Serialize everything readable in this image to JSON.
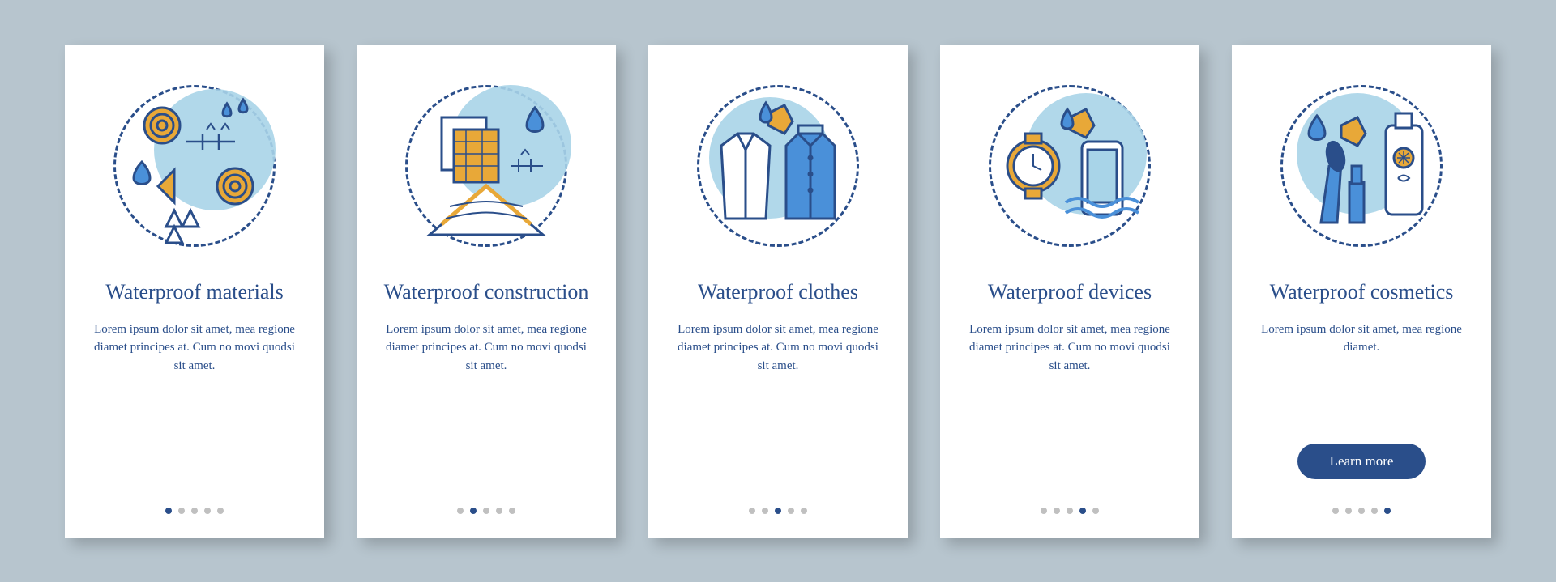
{
  "cards": [
    {
      "title": "Waterproof materials",
      "desc": "Lorem ipsum dolor sit amet, mea regione diamet principes at. Cum no movi quodsi sit amet."
    },
    {
      "title": "Waterproof construction",
      "desc": "Lorem ipsum dolor sit amet, mea regione diamet principes at. Cum no movi quodsi sit amet."
    },
    {
      "title": "Waterproof clothes",
      "desc": "Lorem ipsum dolor sit amet, mea regione diamet principes at. Cum no movi quodsi sit amet."
    },
    {
      "title": "Waterproof devices",
      "desc": "Lorem ipsum dolor sit amet, mea regione diamet principes at. Cum no movi quodsi sit amet."
    },
    {
      "title": "Waterproof cosmetics",
      "desc": "Lorem ipsum dolor sit amet, mea regione diamet."
    }
  ],
  "button_label": "Learn more",
  "colors": {
    "primary": "#2a4e8a",
    "accent": "#e8a838",
    "light": "#a8d4e8",
    "bg": "#b7c5ce"
  }
}
